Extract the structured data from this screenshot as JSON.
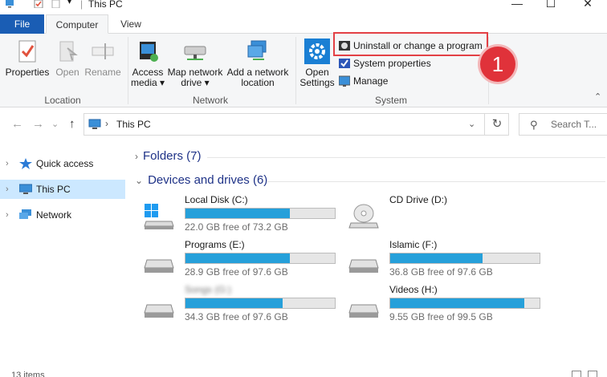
{
  "window": {
    "title": "This PC",
    "minimize": "—",
    "maximize": "☐",
    "close": "✕"
  },
  "tabs": [
    {
      "label": "File"
    },
    {
      "label": "Computer"
    },
    {
      "label": "View"
    }
  ],
  "ribbon": {
    "location": {
      "label": "Location",
      "properties": "Properties",
      "open": "Open",
      "rename": "Rename"
    },
    "network": {
      "label": "Network",
      "access_media_1": "Access",
      "access_media_2": "media ▾",
      "map_drive_1": "Map network",
      "map_drive_2": "drive ▾",
      "add_location_1": "Add a network",
      "add_location_2": "location"
    },
    "system": {
      "label": "System",
      "open_settings_1": "Open",
      "open_settings_2": "Settings",
      "uninstall": "Uninstall or change a program",
      "system_properties": "System properties",
      "manage": "Manage"
    }
  },
  "annotation_badge": "1",
  "address": {
    "path": "This PC",
    "search_placeholder": "Search T..."
  },
  "nav": [
    {
      "label": "Quick access"
    },
    {
      "label": "This PC"
    },
    {
      "label": "Network"
    }
  ],
  "sections": {
    "folders": "Folders (7)",
    "devices": "Devices and drives (6)"
  },
  "drives": [
    {
      "name": "Local Disk (C:)",
      "free": "22.0 GB free of 73.2 GB",
      "used_fraction": 0.7
    },
    {
      "name": "CD Drive (D:)",
      "free": "",
      "used_fraction": 0
    },
    {
      "name": "Programs (E:)",
      "free": "28.9 GB free of 97.6 GB",
      "used_fraction": 0.7
    },
    {
      "name": "Islamic (F:)",
      "free": "36.8 GB free of 97.6 GB",
      "used_fraction": 0.62
    },
    {
      "name": "Songs (G:)",
      "free": "34.3 GB free of 97.6 GB",
      "used_fraction": 0.65
    },
    {
      "name": "Videos (H:)",
      "free": "9.55 GB free of 99.5 GB",
      "used_fraction": 0.9
    }
  ],
  "status": {
    "items": "13 items"
  },
  "colors": {
    "accent": "#1a5db4",
    "progress": "#26a0da",
    "selection": "#cce8ff",
    "highlight": "#e34045"
  }
}
